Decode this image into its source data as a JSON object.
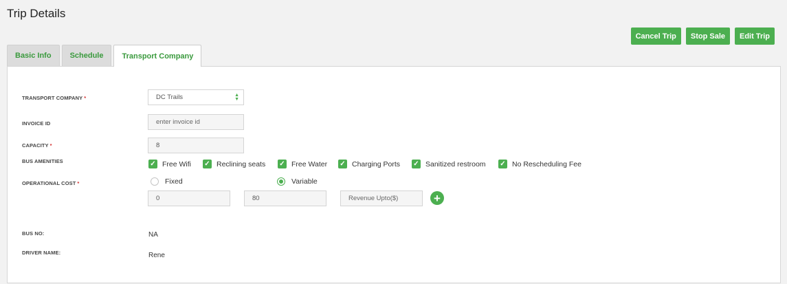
{
  "page_title": "Trip Details",
  "actions": {
    "cancel_trip": "Cancel Trip",
    "stop_sale": "Stop Sale",
    "edit_trip": "Edit Trip"
  },
  "tabs": [
    {
      "label": "Basic Info",
      "active": false
    },
    {
      "label": "Schedule",
      "active": false
    },
    {
      "label": "Transport Company",
      "active": true
    }
  ],
  "form": {
    "transport_company": {
      "label": "TRANSPORT COMPANY",
      "required": "*",
      "value": "DC Trails"
    },
    "invoice_id": {
      "label": "INVOICE ID",
      "placeholder": "enter invoice id"
    },
    "capacity": {
      "label": "CAPACITY",
      "required": "*",
      "value": "8"
    },
    "bus_amenities": {
      "label": "BUS AMENITIES",
      "items": [
        {
          "label": "Free Wifi",
          "checked": true
        },
        {
          "label": "Reclining seats",
          "checked": true
        },
        {
          "label": "Free Water",
          "checked": true
        },
        {
          "label": "Charging Ports",
          "checked": true
        },
        {
          "label": "Sanitized restroom",
          "checked": true
        },
        {
          "label": "No Rescheduling Fee",
          "checked": true
        }
      ]
    },
    "operational_cost": {
      "label": "OPERATIONAL COST",
      "required": "*",
      "options": {
        "fixed": "Fixed",
        "variable": "Variable"
      },
      "selected": "Variable",
      "from_value": "0",
      "to_value": "80",
      "revenue_placeholder": "Revenue Upto($)"
    },
    "bus_no": {
      "label": "BUS NO:",
      "value": "NA"
    },
    "driver_name": {
      "label": "DRIVER NAME:",
      "value": "Rene"
    }
  },
  "colors": {
    "accent": "#4caf50",
    "required": "#d32f2f"
  },
  "icons": {
    "check": "check-icon",
    "add": "plus-icon",
    "select": "select-arrows-icon"
  }
}
